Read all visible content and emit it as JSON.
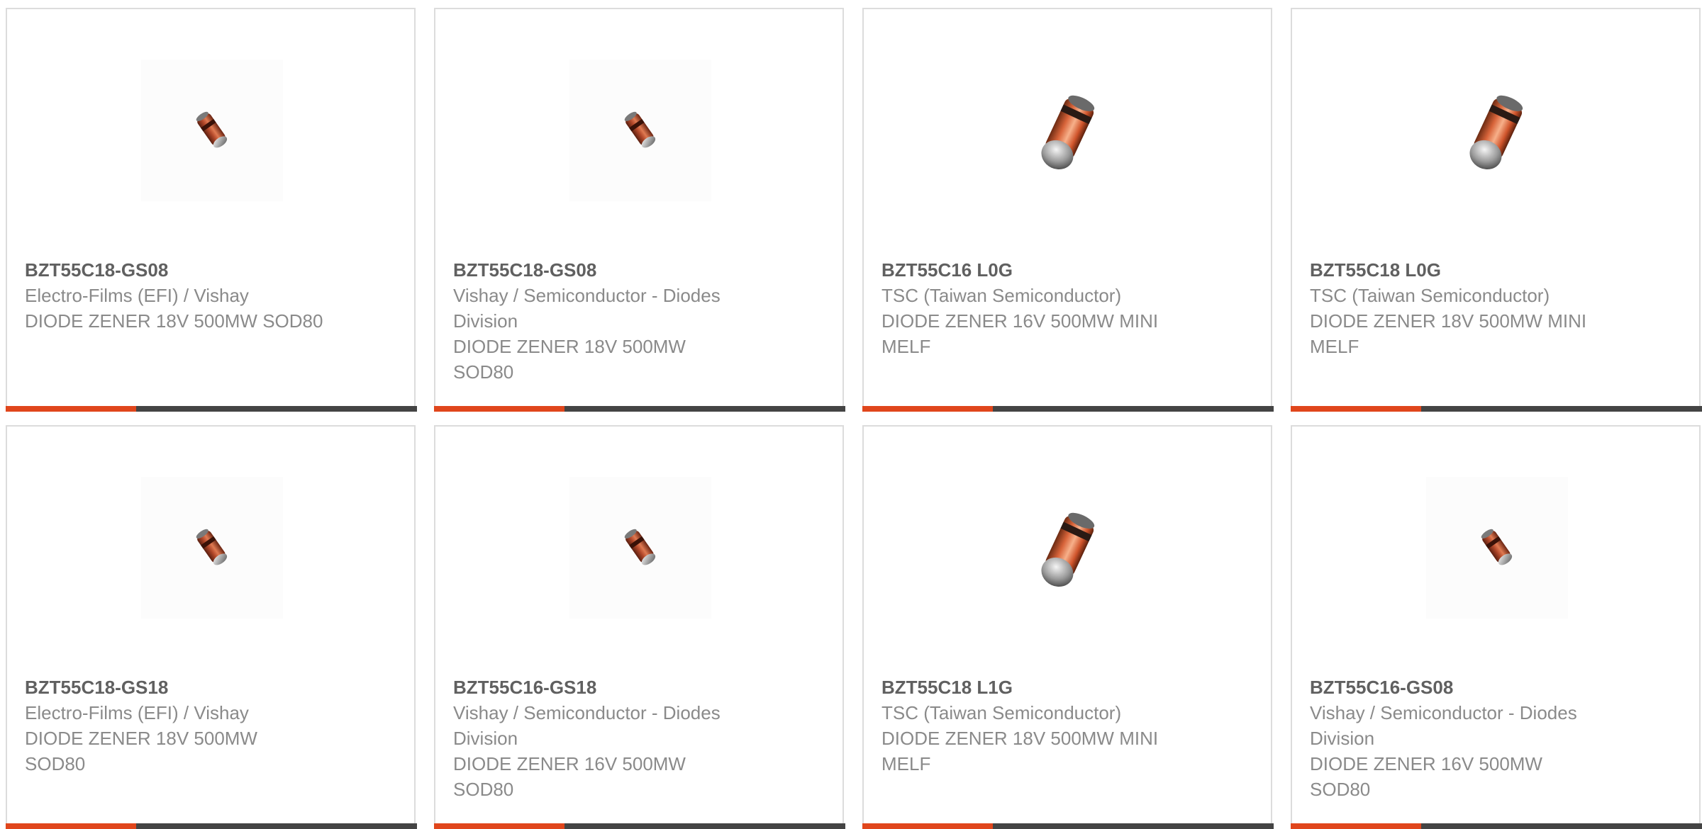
{
  "colors": {
    "accent": "#e0461c",
    "bar": "#444444",
    "border": "#dcdcdc",
    "text": "#8a8a8a",
    "title": "#606060"
  },
  "products": [
    {
      "part_number": "BZT55C18-GS08",
      "manufacturer": "Electro-Films (EFI) / Vishay",
      "description": "DIODE ZENER 18V 500MW SOD80",
      "image": "sod80-diode-icon"
    },
    {
      "part_number": "BZT55C18-GS08",
      "manufacturer": "Vishay / Semiconductor - Diodes Division",
      "description": "DIODE ZENER 18V 500MW SOD80",
      "image": "sod80-diode-icon"
    },
    {
      "part_number": "BZT55C16 L0G",
      "manufacturer": "TSC (Taiwan Semiconductor)",
      "description": "DIODE ZENER 16V 500MW MINI MELF",
      "image": "minimelf-diode-icon"
    },
    {
      "part_number": "BZT55C18 L0G",
      "manufacturer": "TSC (Taiwan Semiconductor)",
      "description": "DIODE ZENER 18V 500MW MINI MELF",
      "image": "minimelf-diode-icon"
    },
    {
      "part_number": "BZT55C18-GS18",
      "manufacturer": "Electro-Films (EFI) / Vishay",
      "description": "DIODE ZENER 18V 500MW SOD80",
      "image": "sod80-diode-icon"
    },
    {
      "part_number": "BZT55C16-GS18",
      "manufacturer": "Vishay / Semiconductor - Diodes Division",
      "description": "DIODE ZENER 16V 500MW SOD80",
      "image": "sod80-diode-icon"
    },
    {
      "part_number": "BZT55C18 L1G",
      "manufacturer": "TSC (Taiwan Semiconductor)",
      "description": "DIODE ZENER 18V 500MW MINI MELF",
      "image": "minimelf-diode-icon"
    },
    {
      "part_number": "BZT55C16-GS08",
      "manufacturer": "Vishay / Semiconductor - Diodes Division",
      "description": "DIODE ZENER 16V 500MW SOD80",
      "image": "sod80-diode-icon"
    }
  ]
}
